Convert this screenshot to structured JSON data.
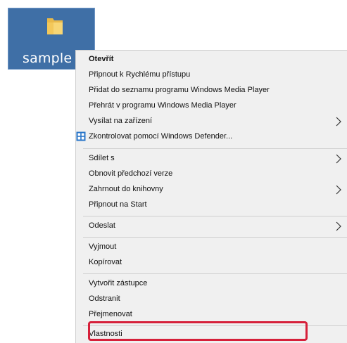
{
  "desktop": {
    "icon_label": "sample",
    "icon": "folder-icon"
  },
  "menu": {
    "items": [
      {
        "label": "Otevřít",
        "bold": true
      },
      {
        "label": "Připnout k Rychlému přístupu"
      },
      {
        "label": "Přidat do seznamu programu Windows Media Player"
      },
      {
        "label": "Přehrát v programu Windows Media Player"
      },
      {
        "label": "Vysílat na zařízení",
        "submenu": true
      },
      {
        "label": "Zkontrolovat pomocí Windows Defender...",
        "icon": "windows-defender-icon"
      },
      {
        "label": "Sdílet s",
        "submenu": true
      },
      {
        "label": "Obnovit předchozí verze"
      },
      {
        "label": "Zahrnout do knihovny",
        "submenu": true
      },
      {
        "label": "Připnout na Start"
      },
      {
        "label": "Odeslat",
        "submenu": true
      },
      {
        "label": "Vyjmout"
      },
      {
        "label": "Kopírovat"
      },
      {
        "label": "Vytvořit zástupce"
      },
      {
        "label": "Odstranit"
      },
      {
        "label": "Přejmenovat"
      },
      {
        "label": "Vlastnosti",
        "highlighted": true
      }
    ]
  },
  "colors": {
    "highlight_border": "#d6203a",
    "selection_bg": "#3f6fa6"
  }
}
